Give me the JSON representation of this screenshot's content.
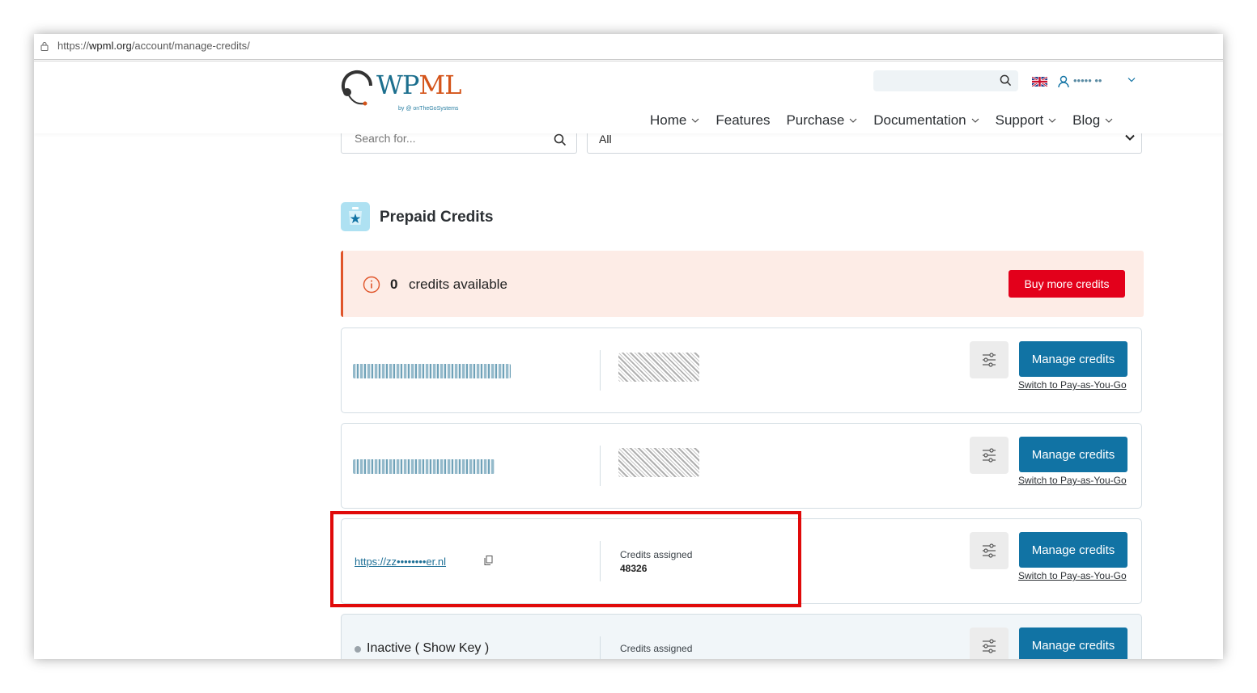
{
  "browser": {
    "url_prefix": "https://",
    "url_domain": "wpml.org",
    "url_path": "/account/manage-credits/"
  },
  "header": {
    "logo_w": "W",
    "logo_p": "P",
    "logo_ml": "ML",
    "logo_sub": "by @ onTheGoSystems",
    "search_placeholder": "",
    "user_name": "••••• ••",
    "nav": [
      {
        "label": "Home",
        "has_dropdown": true
      },
      {
        "label": "Features",
        "has_dropdown": false
      },
      {
        "label": "Purchase",
        "has_dropdown": true
      },
      {
        "label": "Documentation",
        "has_dropdown": true
      },
      {
        "label": "Support",
        "has_dropdown": true
      },
      {
        "label": "Blog",
        "has_dropdown": true
      }
    ]
  },
  "filters": {
    "search_placeholder": "Search for...",
    "select_value": "All"
  },
  "section": {
    "title": "Prepaid Credits"
  },
  "alert": {
    "count": "0",
    "text": "credits available",
    "button": "Buy more credits",
    "accent": "#e0552a"
  },
  "cards": [
    {
      "type": "redacted",
      "manage": "Manage credits",
      "switch": "Switch to Pay-as-You-Go"
    },
    {
      "type": "redacted",
      "manage": "Manage credits",
      "switch": "Switch to Pay-as-You-Go"
    },
    {
      "type": "site",
      "site_url": "https://zz••••••••er.nl",
      "credits_label": "Credits assigned",
      "credits_value": "48326",
      "manage": "Manage credits",
      "switch": "Switch to Pay-as-You-Go"
    },
    {
      "type": "inactive",
      "status": "Inactive ( Show Key )",
      "credits_label": "Credits assigned",
      "manage": "Manage credits"
    }
  ],
  "colors": {
    "primary": "#1173a4",
    "danger": "#e3001b",
    "highlight": "#e00a0a"
  }
}
